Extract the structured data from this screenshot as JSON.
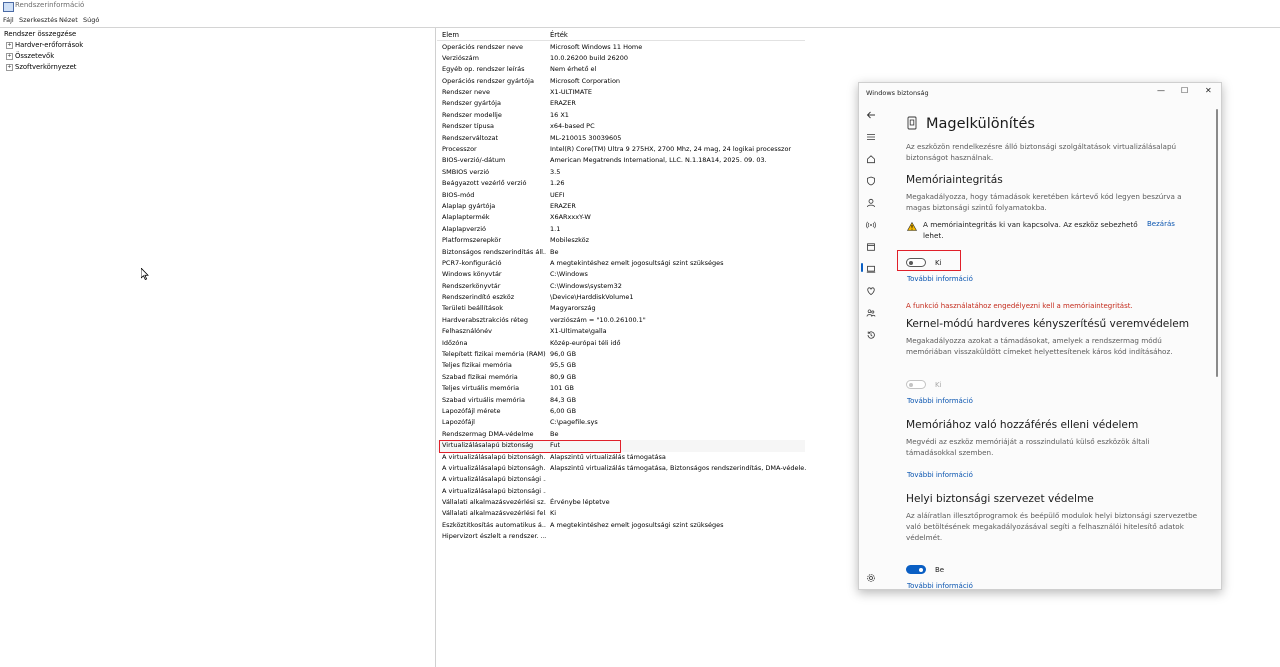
{
  "window": {
    "title": "Rendszerinformáció",
    "menu": [
      "Fájl",
      "Szerkesztés",
      "Nézet",
      "Súgó"
    ]
  },
  "tree": {
    "root": "Rendszer összegzése",
    "children": [
      "Hardver-erőforrások",
      "Összetevők",
      "Szoftverkörnyezet"
    ]
  },
  "table": {
    "headers": [
      "Elem",
      "Érték"
    ],
    "rows": [
      [
        "Operációs rendszer neve",
        "Microsoft Windows 11 Home"
      ],
      [
        "Verziószám",
        "10.0.26200 build 26200"
      ],
      [
        "Egyéb op. rendszer leírás",
        "Nem érhető el"
      ],
      [
        "Operációs rendszer gyártója",
        "Microsoft Corporation"
      ],
      [
        "Rendszer neve",
        "X1-ULTIMATE"
      ],
      [
        "Rendszer gyártója",
        "ERAZER"
      ],
      [
        "Rendszer modellje",
        "16 X1"
      ],
      [
        "Rendszer típusa",
        "x64-based PC"
      ],
      [
        "Rendszerváltozat",
        "ML-210015 30039605"
      ],
      [
        "Processzor",
        "Intel(R) Core(TM) Ultra 9 275HX, 2700 Mhz, 24 mag, 24 logikai processzor"
      ],
      [
        "BIOS-verzió/-dátum",
        "American Megatrends International, LLC. N.1.18A14, 2025. 09. 03."
      ],
      [
        "SMBIOS verzió",
        "3.5"
      ],
      [
        "Beágyazott vezérlő verzió",
        "1.26"
      ],
      [
        "BIOS-mód",
        "UEFI"
      ],
      [
        "Alaplap gyártója",
        "ERAZER"
      ],
      [
        "Alaplaptermék",
        "X6ARxxxY-W"
      ],
      [
        "Alaplapverzió",
        "1.1"
      ],
      [
        "Platformszerepkör",
        "Mobileszköz"
      ],
      [
        "Biztonságos rendszerindítás áll...",
        "Be"
      ],
      [
        "PCR7-konfiguráció",
        "A megtekintéshez emelt jogosultsági szint szükséges"
      ],
      [
        "Windows könyvtár",
        "C:\\Windows"
      ],
      [
        "Rendszerkönyvtár",
        "C:\\Windows\\system32"
      ],
      [
        "Rendszerindító eszköz",
        "\\Device\\HarddiskVolume1"
      ],
      [
        "Területi beállítások",
        "Magyarország"
      ],
      [
        "Hardverabsztrakciós réteg",
        "verziószám = \"10.0.26100.1\""
      ],
      [
        "Felhasználónév",
        "X1-Ultimate\\galla"
      ],
      [
        "Időzóna",
        "Közép-európai téli idő"
      ],
      [
        "Telepített fizikai memória (RAM)",
        "96,0 GB"
      ],
      [
        "Teljes fizikai memória",
        "95,5 GB"
      ],
      [
        "Szabad fizikai memória",
        "80,9 GB"
      ],
      [
        "Teljes virtuális memória",
        "101 GB"
      ],
      [
        "Szabad virtuális memória",
        "84,3 GB"
      ],
      [
        "Lapozófájl mérete",
        "6,00 GB"
      ],
      [
        "Lapozófájl",
        "C:\\pagefile.sys"
      ],
      [
        "Rendszermag DMA-védelme",
        "Be"
      ],
      [
        "Virtualizálásalapú biztonság",
        "Fut"
      ],
      [
        "A virtualizálásalapú biztonságh...",
        "Alapszintű virtualizálás támogatása"
      ],
      [
        "A virtualizálásalapú biztonságh...",
        "Alapszintű virtualizálás támogatása, Biztonságos rendszerindítás, DMA-védele..."
      ],
      [
        "A virtualizálásalapú biztonsági ...",
        ""
      ],
      [
        "A virtualizálásalapú biztonsági ...",
        ""
      ],
      [
        "Vállalati alkalmazásvezérlési sz...",
        "Érvénybe léptetve"
      ],
      [
        "Vállalati alkalmazásvezérlési fel...",
        "Ki"
      ],
      [
        "Eszköztitkosítás automatikus á...",
        "A megtekintéshez emelt jogosultsági szint szükséges"
      ],
      [
        "Hipervizort észlelt a rendszer. ...",
        ""
      ]
    ]
  },
  "security": {
    "window_title": "Windows biztonság",
    "controls": [
      "—",
      "☐",
      "✕"
    ],
    "page_title": "Magelkülönítés",
    "intro": "Az eszközön rendelkezésre álló biztonsági szolgáltatások virtualizálásalapú biztonságot használnak.",
    "memory": {
      "heading": "Memóriaintegritás",
      "desc": "Megakadályozza, hogy támadások keretében kártevő kód legyen beszúrva a magas biztonsági szintű folyamatokba.",
      "warning": "A memóriaintegritás ki van kapcsolva. Az eszköz sebezhető lehet.",
      "dismiss": "Bezárás",
      "toggle_label": "Ki",
      "more": "További információ",
      "error": "A funkció használatához engedélyezni kell a memóriaintegritást."
    },
    "kernel": {
      "heading": "Kernel-módú hardveres kényszerítésű veremvédelem",
      "desc": "Megakadályozza azokat a támadásokat, amelyek a rendszermag módú memóriában visszaküldött címeket helyettesítenek káros kód indításához.",
      "toggle_label": "Ki",
      "more": "További információ"
    },
    "access": {
      "heading": "Memóriához való hozzáférés elleni védelem",
      "desc": "Megvédi az eszköz memóriáját a rosszindulatú külső eszközök általi támadásokkal szemben.",
      "more": "További információ"
    },
    "lsa": {
      "heading": "Helyi biztonsági szervezet védelme",
      "desc": "Az aláíratlan illesztőprogramok és beépülő modulok helyi biztonsági szervezetbe való betöltésének megakadályozásával segíti a felhasználói hitelesítő adatok védelmét.",
      "toggle_label": "Be",
      "more": "További információ"
    }
  }
}
